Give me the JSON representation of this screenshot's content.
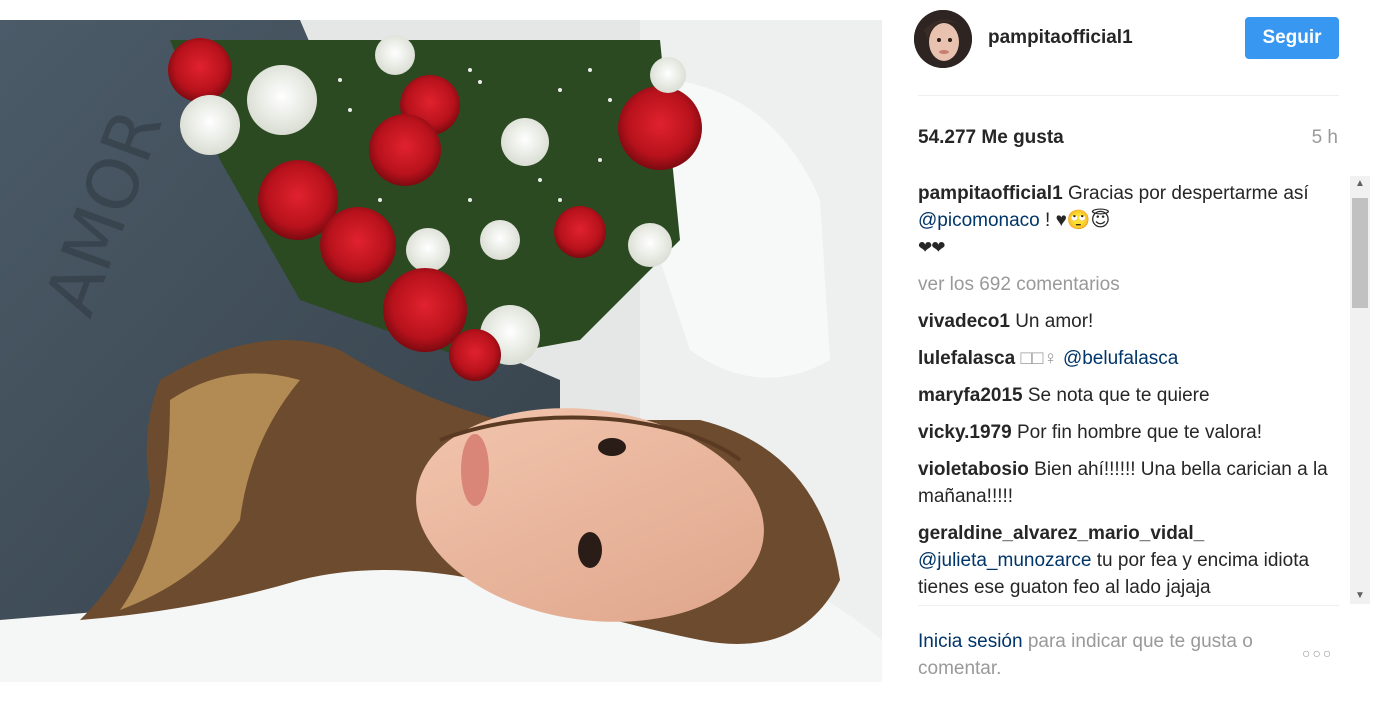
{
  "post": {
    "username": "pampitaofficial1",
    "follow_label": "Seguir",
    "likes": "54.277 Me gusta",
    "time": "5 h"
  },
  "caption": {
    "user": "pampitaofficial1",
    "text_before": "Gracias por despertarme así",
    "mention": "@picomonaco",
    "text_after": "! ♥🙄😇",
    "emoji_line": "❤❤"
  },
  "view_all": "ver los 692 comentarios",
  "comments": [
    {
      "user": "vivadeco1",
      "text": "Un amor!",
      "mention": ""
    },
    {
      "user": "lulefalasca",
      "text": "□□♀",
      "mention": "@belufalasca"
    },
    {
      "user": "maryfa2015",
      "text": "Se nota que te quiere",
      "mention": ""
    },
    {
      "user": "vicky.1979",
      "text": "Por fin hombre que te valora!",
      "mention": ""
    },
    {
      "user": "violetabosio",
      "text": "Bien ahí!!!!!! Una bella carician a la mañana!!!!!",
      "mention": ""
    },
    {
      "user": "geraldine_alvarez_mario_vidal_",
      "mention": "@julieta_munozarce",
      "text": "tu por fea y encima idiota tienes ese guaton feo al lado jajaja"
    }
  ],
  "footer": {
    "login_link": "Inicia sesión",
    "rest": "para indicar que te gusta o comentar.",
    "more": "○○○"
  },
  "colors": {
    "accent": "#3897f0",
    "link": "#003569",
    "muted": "#999999"
  }
}
